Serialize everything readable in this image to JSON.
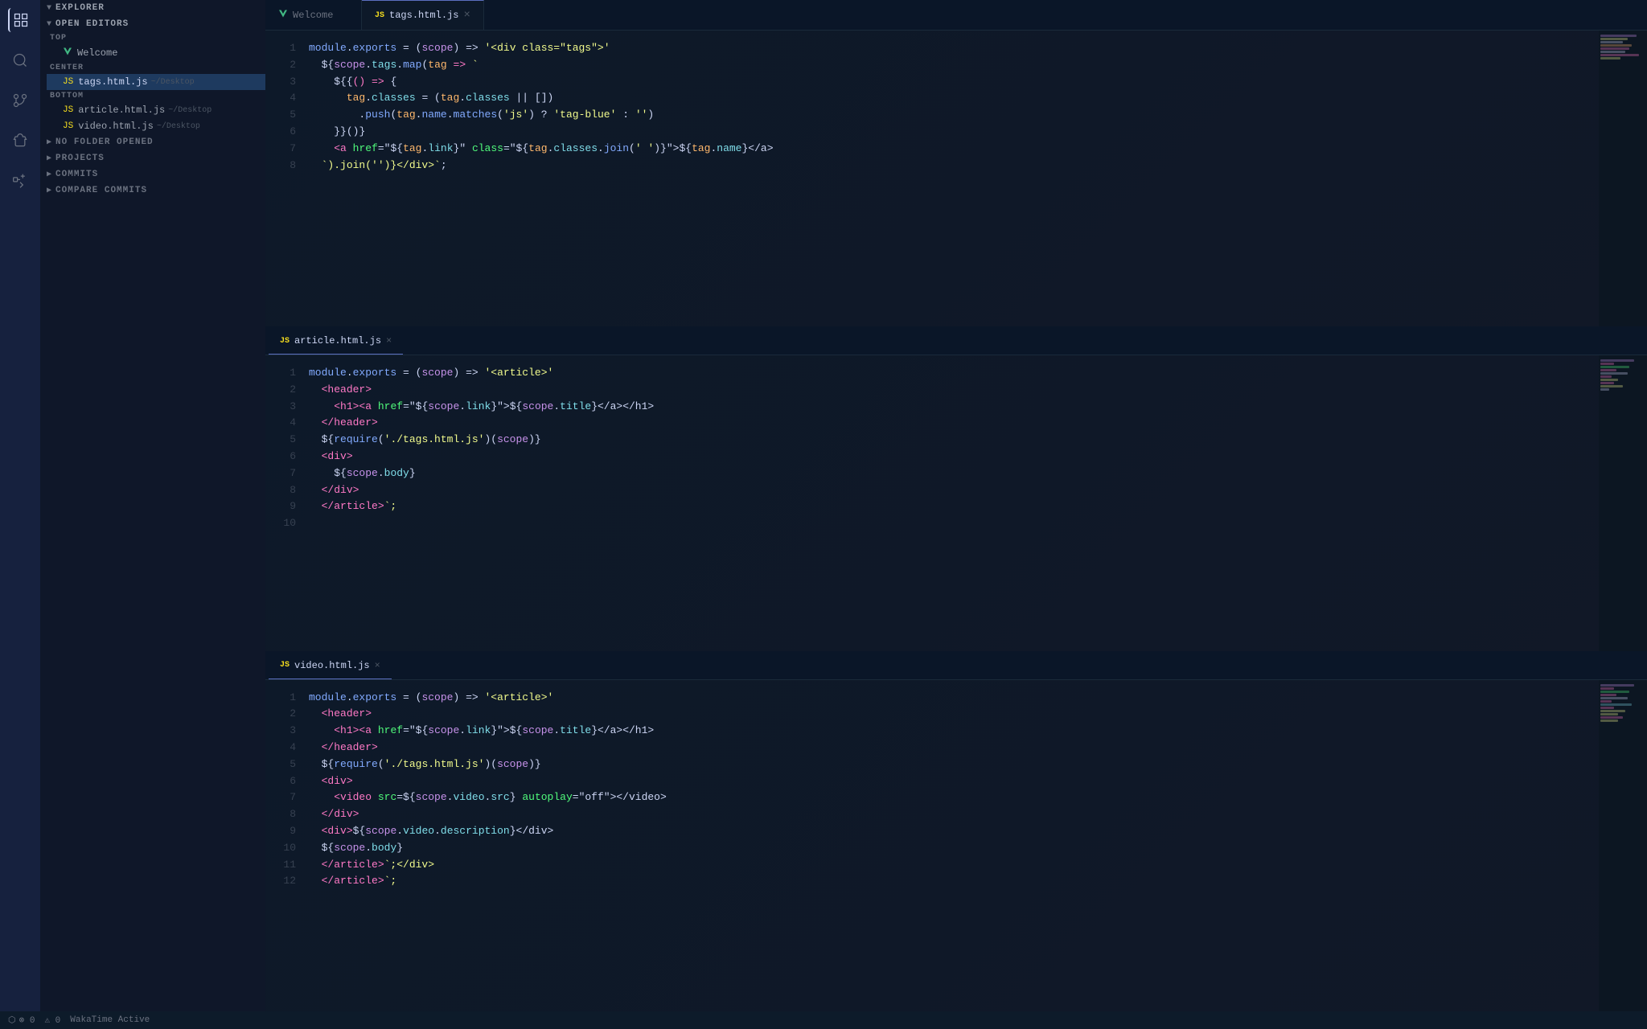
{
  "activityBar": {
    "icons": [
      "⊞",
      "🔍",
      "⎇",
      "🐛",
      "⬡"
    ]
  },
  "sidebar": {
    "explorerLabel": "EXPLORER",
    "openEditorsLabel": "OPEN EDITORS",
    "topLabel": "TOP",
    "centerLabel": "CENTER",
    "bottomLabel": "BOTTOM",
    "noFolderLabel": "NO FOLDER OPENED",
    "projectsLabel": "PROJECTS",
    "commitsLabel": "COMMITS",
    "compareCommitsLabel": "COMPARE COMMITS",
    "files": {
      "top": [
        {
          "name": "Welcome",
          "icon": "vue",
          "type": "welcome"
        }
      ],
      "center": [
        {
          "name": "tags.html.js",
          "path": "~/Desktop",
          "icon": "js"
        }
      ],
      "bottom": [
        {
          "name": "article.html.js",
          "path": "~/Desktop",
          "icon": "js"
        },
        {
          "name": "video.html.js",
          "path": "~/Desktop",
          "icon": "js"
        }
      ]
    }
  },
  "tabs": {
    "welcome": {
      "label": "Welcome",
      "icon": "vue",
      "active": false
    },
    "tagsHtml": {
      "label": "tags.html.js",
      "icon": "js",
      "active": true,
      "closable": true
    }
  },
  "panels": {
    "tagsPanel": {
      "filename": "tags.html.js",
      "lines": [
        "module.exports = (scope) => '<div class=\"tags\">'",
        "  ${scope.tags.map(tag => `",
        "    ${{() => {",
        "      tag.classes = (tag.classes || [])",
        "        .push(tag.name.matches('js') ? 'tag-blue' : '')",
        "    }}()}",
        "    <a href=\"${tag.link}\" class=\"${tag.classes.join(' ')}\">${tag.name}</a>",
        "  `).join('')}</div>`;"
      ],
      "activeTab": "tags.html.js"
    },
    "articlePanel": {
      "filename": "article.html.js",
      "lines": [
        "module.exports = (scope) => '<article>'",
        "  <header>",
        "    <h1><a href=\"${scope.link}\">${scope.title}</a></h1>",
        "  </header>",
        "  ${require('./tags.html.js')(scope)}",
        "  <div>",
        "    ${scope.body}",
        "  </div>",
        "  </article>`;",
        ""
      ],
      "activeTab": "article.html.js"
    },
    "videoPanel": {
      "filename": "video.html.js",
      "lines": [
        "module.exports = (scope) => '<article>'",
        "  <header>",
        "    <h1><a href=\"${scope.link}\">${scope.title}</a></h1>",
        "  </header>",
        "  ${require('./tags.html.js')(scope)}",
        "  <div>",
        "    <video src=${scope.video.src} autoplay=\"off\"></video>",
        "  </div>",
        "  <div>${scope.video.description}</div>",
        "  ${scope.body}",
        "  </article>`;</div>",
        "  </article>`;"
      ],
      "activeTab": "video.html.js"
    }
  },
  "statusBar": {
    "gitIcon": "⬡",
    "errors": "⊗ 0",
    "warnings": "⚠ 0",
    "wakatime": "WakaTime Active"
  }
}
